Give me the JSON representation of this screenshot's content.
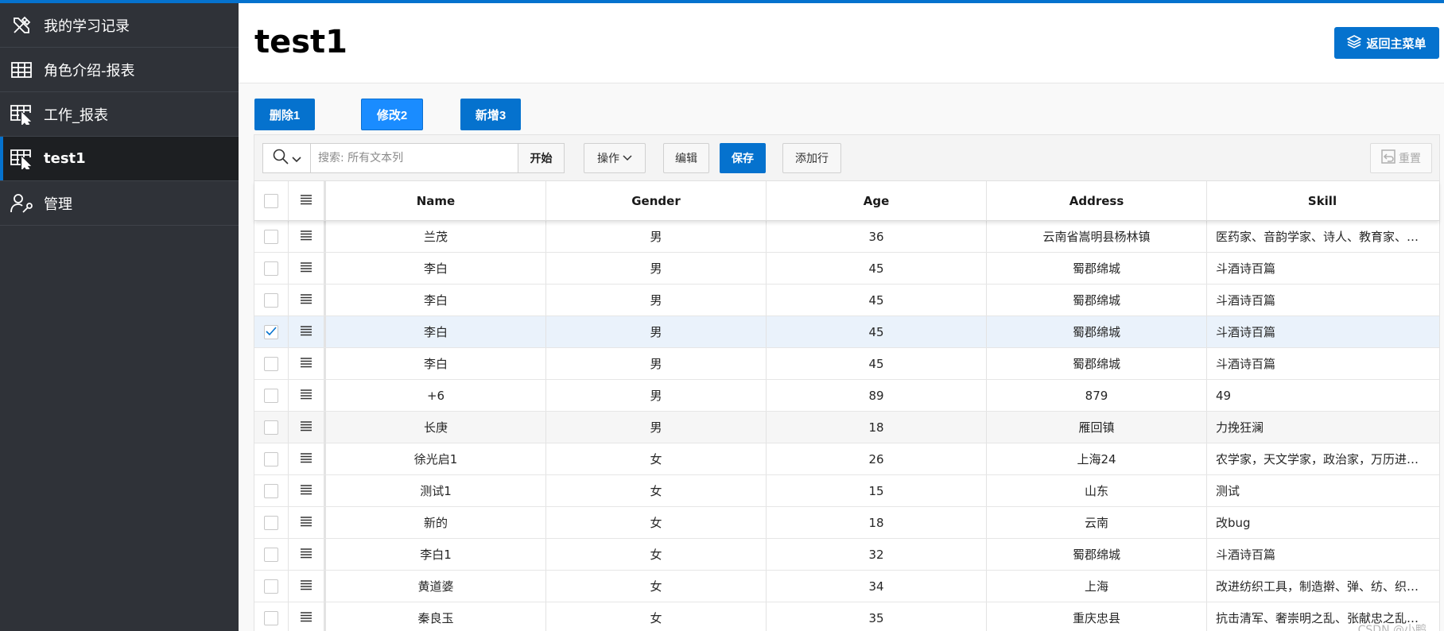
{
  "sidebar": {
    "items": [
      {
        "label": "我的学习记录",
        "icon": "tools-icon",
        "active": false
      },
      {
        "label": "角色介绍-报表",
        "icon": "table-icon",
        "active": false
      },
      {
        "label": "工作_报表",
        "icon": "table-cursor-icon",
        "active": false
      },
      {
        "label": "test1",
        "icon": "table-cursor-icon",
        "active": true
      },
      {
        "label": "管理",
        "icon": "user-wrench-icon",
        "active": false
      }
    ]
  },
  "header": {
    "title": "test1",
    "back_label": "返回主菜单"
  },
  "actions": {
    "delete_label": "删除1",
    "edit_label": "修改2",
    "add_label": "新增3"
  },
  "toolbar": {
    "search_placeholder": "搜索: 所有文本列",
    "start_label": "开始",
    "actions_label": "操作",
    "edit_label": "编辑",
    "save_label": "保存",
    "add_row_label": "添加行",
    "reset_label": "重置"
  },
  "table": {
    "columns": [
      "Name",
      "Gender",
      "Age",
      "Address",
      "Skill"
    ],
    "rows": [
      {
        "name": "兰茂",
        "gender": "男",
        "age": "36",
        "address": "云南省嵩明县杨林镇",
        "skill": "医药家、音韵学家、诗人、教育家、…",
        "checked": false,
        "state": ""
      },
      {
        "name": "李白",
        "gender": "男",
        "age": "45",
        "address": "蜀郡绵城",
        "skill": "斗酒诗百篇",
        "checked": false,
        "state": ""
      },
      {
        "name": "李白",
        "gender": "男",
        "age": "45",
        "address": "蜀郡绵城",
        "skill": "斗酒诗百篇",
        "checked": false,
        "state": ""
      },
      {
        "name": "李白",
        "gender": "男",
        "age": "45",
        "address": "蜀郡绵城",
        "skill": "斗酒诗百篇",
        "checked": true,
        "state": "selected"
      },
      {
        "name": "李白",
        "gender": "男",
        "age": "45",
        "address": "蜀郡绵城",
        "skill": "斗酒诗百篇",
        "checked": false,
        "state": ""
      },
      {
        "name": "+6",
        "gender": "男",
        "age": "89",
        "address": "879",
        "skill": "49",
        "checked": false,
        "state": ""
      },
      {
        "name": "长庚",
        "gender": "男",
        "age": "18",
        "address": "雁回镇",
        "skill": "力挽狂澜",
        "checked": false,
        "state": "shaded"
      },
      {
        "name": "徐光启1",
        "gender": "女",
        "age": "26",
        "address": "上海24",
        "skill": "农学家，天文学家，政治家，万历进…",
        "checked": false,
        "state": ""
      },
      {
        "name": "测试1",
        "gender": "女",
        "age": "15",
        "address": "山东",
        "skill": "测试",
        "checked": false,
        "state": ""
      },
      {
        "name": "新的",
        "gender": "女",
        "age": "18",
        "address": "云南",
        "skill": "改bug",
        "checked": false,
        "state": ""
      },
      {
        "name": "李白1",
        "gender": "女",
        "age": "32",
        "address": "蜀郡绵城",
        "skill": "斗酒诗百篇",
        "checked": false,
        "state": ""
      },
      {
        "name": "黄道婆",
        "gender": "女",
        "age": "34",
        "address": "上海",
        "skill": "改进纺织工具，制造擀、弹、纺、织…",
        "checked": false,
        "state": ""
      },
      {
        "name": "秦良玉",
        "gender": "女",
        "age": "35",
        "address": "重庆忠县",
        "skill": "抗击清军、奢崇明之乱、张献忠之乱…",
        "checked": false,
        "state": ""
      }
    ]
  },
  "watermark": "CSDN @小鸭",
  "colors": {
    "accent": "#0572ce",
    "sidebar_bg": "#2f3238",
    "selected_row": "#eaf2fb"
  }
}
